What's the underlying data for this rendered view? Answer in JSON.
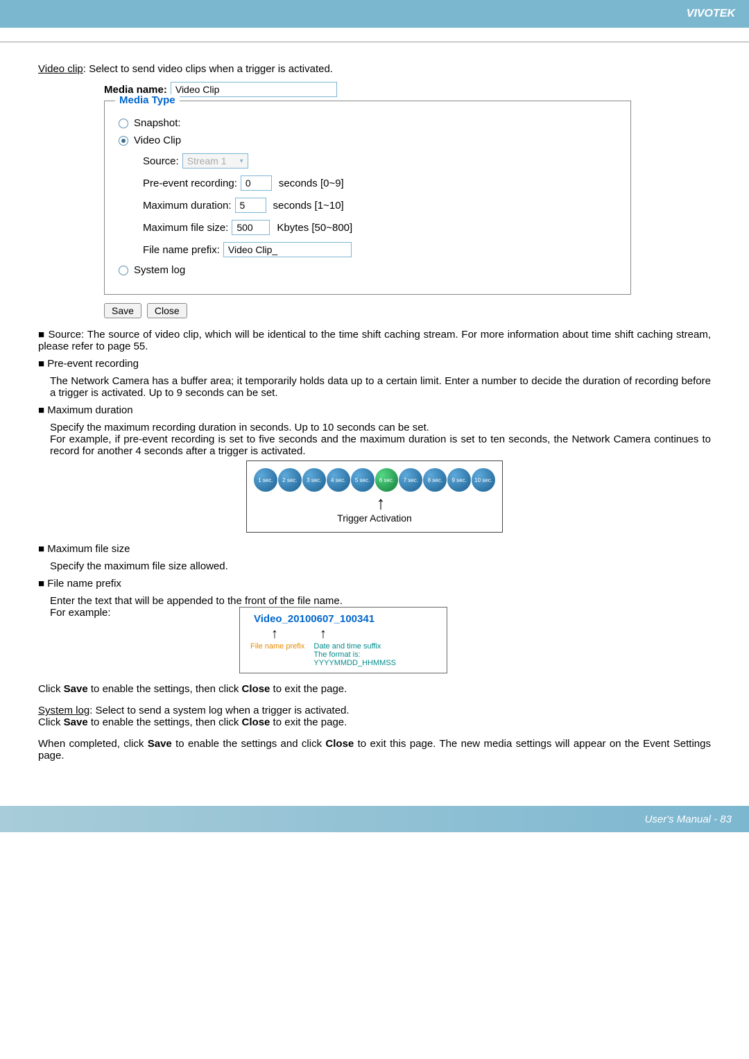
{
  "header": {
    "brand": "VIVOTEK"
  },
  "intro": {
    "title": "Video clip",
    "desc": ": Select to send video clips when a trigger is activated."
  },
  "form": {
    "media_name_label": "Media name:",
    "media_name_value": "Video Clip",
    "legend": "Media Type",
    "snapshot_label": "Snapshot:",
    "videoclip_label": "Video Clip",
    "source_label": "Source:",
    "source_value": "Stream 1",
    "pre_event_label": "Pre-event recording:",
    "pre_event_value": "0",
    "pre_event_hint": "seconds [0~9]",
    "max_duration_label": "Maximum duration:",
    "max_duration_value": "5",
    "max_duration_hint": "seconds [1~10]",
    "max_filesize_label": "Maximum file size:",
    "max_filesize_value": "500",
    "max_filesize_hint": "Kbytes [50~800]",
    "prefix_label": "File name prefix:",
    "prefix_value": "Video Clip_",
    "systemlog_label": "System log",
    "save_btn": "Save",
    "close_btn": "Close"
  },
  "body": {
    "source_desc": "■ Source: The source of video clip, which will be identical to the time shift caching stream. For more information about time shift caching stream, please refer to page 55.",
    "pre_event_title": "■ Pre-event recording",
    "pre_event_desc": "The Network Camera has a buffer area; it temporarily holds data up to a certain limit. Enter a number to decide the duration of recording before a trigger is activated. Up to 9 seconds can be set.",
    "max_duration_title": "■ Maximum duration",
    "max_duration_desc1": "Specify the maximum recording duration in seconds. Up to 10 seconds can be set.",
    "max_duration_desc2": "For example, if pre-event recording is set to five seconds and the maximum duration is set to ten seconds, the Network Camera continues to record for another 4 seconds after a trigger is activated.",
    "max_filesize_title": "■ Maximum file size",
    "max_filesize_desc": "Specify the maximum file size allowed.",
    "prefix_title": "■ File name prefix",
    "prefix_desc": "Enter the text that will be appended to the front of the file name.",
    "prefix_example_label": "For example:",
    "save_close_1": "Click Save to enable the settings, then click Close to exit the page.",
    "systemlog_title": "System log",
    "systemlog_desc": ": Select to send a system log when a trigger is activated.",
    "save_close_2": "Click Save to enable the settings, then click Close to exit the page.",
    "final": "When completed, click Save to enable the settings and click Close to exit this page. The new media settings will appear on the Event Settings page."
  },
  "diagram": {
    "circles": [
      "1 sec.",
      "2 sec.",
      "3 sec.",
      "4 sec.",
      "5 sec.",
      "6 sec.",
      "7 sec.",
      "8 sec.",
      "9 sec.",
      "10 sec."
    ],
    "highlight_index": 5,
    "trigger_label": "Trigger Activation"
  },
  "example": {
    "filename": "Video_20100607_100341",
    "prefix_label": "File name prefix",
    "suffix_label1": "Date and time suffix",
    "suffix_label2": "The format is: YYYYMMDD_HHMMSS"
  },
  "footer": {
    "text": "User's Manual - 83"
  }
}
